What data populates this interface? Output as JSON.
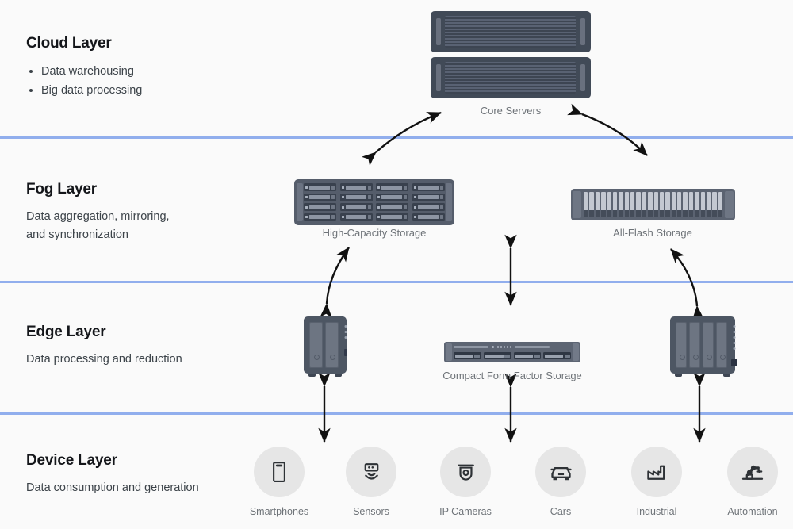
{
  "theme": {
    "background": "#fafafa",
    "divider_color": "#91aeed",
    "hardware_color": "#4d5663",
    "caption_color": "#6e7378",
    "icon_circle_color": "#e6e6e6",
    "arrow_color": "#111111"
  },
  "layers": [
    {
      "id": "cloud",
      "title": "Cloud Layer",
      "bullets": [
        "Data warehousing",
        "Big data processing"
      ]
    },
    {
      "id": "fog",
      "title": "Fog Layer",
      "subtitle_line1": "Data aggregation, mirroring,",
      "subtitle_line2": "and synchronization"
    },
    {
      "id": "edge",
      "title": "Edge Layer",
      "subtitle": "Data processing and reduction"
    },
    {
      "id": "device",
      "title": "Device Layer",
      "subtitle": "Data consumption and generation"
    }
  ],
  "hardware": {
    "core_servers": {
      "label": "Core Servers",
      "icon": "rack-server-icon",
      "units": 2
    },
    "high_capacity_storage": {
      "label": "High-Capacity Storage",
      "icon": "disk-array-icon",
      "bay_rows": 4,
      "bay_cols": 4
    },
    "all_flash_storage": {
      "label": "All-Flash Storage",
      "icon": "flash-array-icon",
      "slots": 24
    },
    "compact_form_factor_storage": {
      "label": "Compact Form Factor Storage",
      "icon": "compact-storage-icon",
      "bays": 4
    },
    "edge_nas_left": {
      "icon": "nas-2bay-icon",
      "bays": 2
    },
    "edge_nas_right": {
      "icon": "nas-4bay-icon",
      "bays": 4
    }
  },
  "devices": [
    {
      "label": "Smartphones",
      "icon": "smartphone-icon"
    },
    {
      "label": "Sensors",
      "icon": "sensor-icon"
    },
    {
      "label": "IP Cameras",
      "icon": "dome-camera-icon"
    },
    {
      "label": "Cars",
      "icon": "car-icon"
    },
    {
      "label": "Industrial",
      "icon": "factory-icon"
    },
    {
      "label": "Automation",
      "icon": "robot-arm-icon"
    }
  ],
  "connections": [
    {
      "from": "core_servers",
      "to": "high_capacity_storage",
      "style": "curved",
      "heads": "both"
    },
    {
      "from": "core_servers",
      "to": "all_flash_storage",
      "style": "curved",
      "heads": "both"
    },
    {
      "from": "high_capacity_storage",
      "to": "edge_nas_left",
      "style": "curved",
      "heads": "both"
    },
    {
      "from": "fog",
      "to": "compact_form_factor_storage",
      "style": "straight",
      "heads": "both"
    },
    {
      "from": "all_flash_storage",
      "to": "edge_nas_right",
      "style": "curved",
      "heads": "both"
    },
    {
      "from": "edge_nas_left",
      "to": "device_smartphones",
      "style": "straight",
      "heads": "both"
    },
    {
      "from": "compact_form_factor_storage",
      "to": "device_cameras",
      "style": "straight",
      "heads": "both"
    },
    {
      "from": "edge_nas_right",
      "to": "device_industrial",
      "style": "straight",
      "heads": "both"
    }
  ]
}
